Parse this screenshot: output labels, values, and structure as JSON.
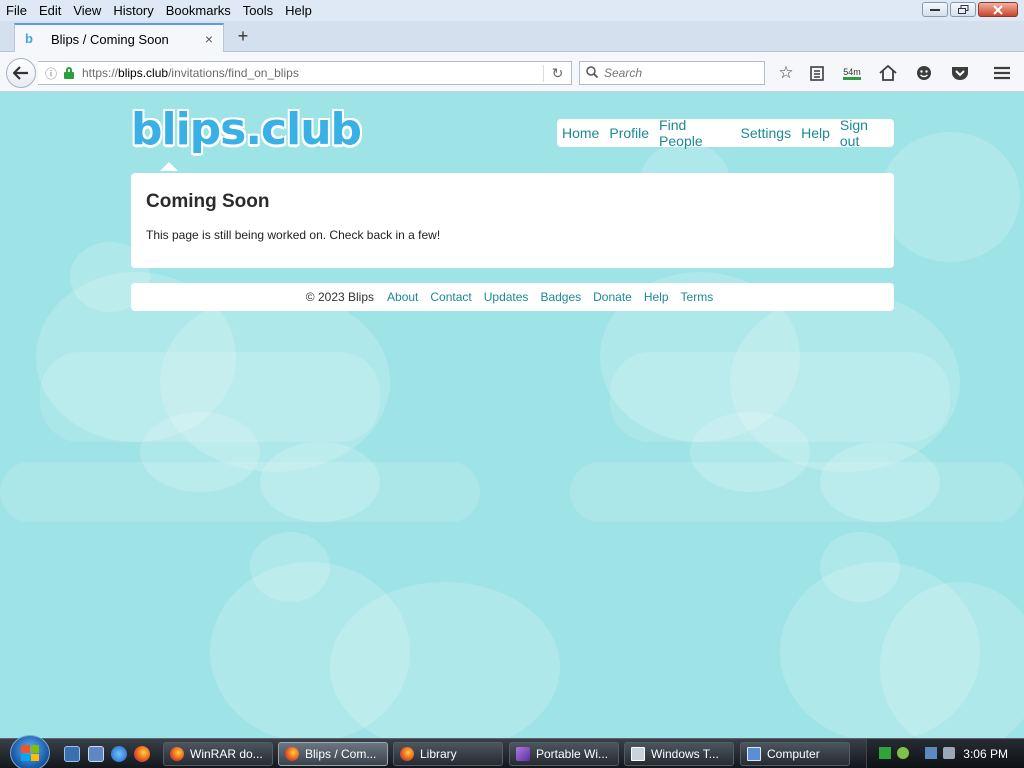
{
  "menubar": {
    "items": [
      "File",
      "Edit",
      "View",
      "History",
      "Bookmarks",
      "Tools",
      "Help"
    ]
  },
  "window": {
    "minimize_icon": "minimize-icon",
    "restore_icon": "restore-icon",
    "close_icon": "close-icon"
  },
  "tab": {
    "title": "Blips / Coming Soon",
    "favicon_text": "b",
    "close_glyph": "×",
    "newtab_glyph": "+"
  },
  "navbar": {
    "back_glyph": "🡐",
    "url_scheme": "https://",
    "url_host": "blips.club",
    "url_path": "/invitations/find_on_blips",
    "reload_glyph": "↻",
    "search_placeholder": "Search",
    "timer_label": "54m"
  },
  "site": {
    "logo_text": "blips.club",
    "nav": [
      "Home",
      "Profile",
      "Find People",
      "Settings",
      "Help",
      "Sign out"
    ],
    "card": {
      "title": "Coming Soon",
      "text": "This page is still being worked on. Check back in a few!"
    },
    "footer": {
      "copyright": "© 2023 Blips",
      "links": [
        "About",
        "Contact",
        "Updates",
        "Badges",
        "Donate",
        "Help",
        "Terms"
      ]
    },
    "colors": {
      "background": "#9ee3e6",
      "link": "#1a8a94",
      "logo": "#39b0e6"
    }
  },
  "taskbar": {
    "buttons": [
      {
        "label": "WinRAR do...",
        "icon": "firefox-icon"
      },
      {
        "label": "Blips / Com...",
        "icon": "firefox-icon"
      },
      {
        "label": "Library",
        "icon": "firefox-icon"
      },
      {
        "label": "Portable Wi...",
        "icon": "portable-icon"
      },
      {
        "label": "Windows T...",
        "icon": "terminal-icon"
      },
      {
        "label": "Computer",
        "icon": "computer-icon"
      }
    ],
    "clock": "3:06 PM"
  }
}
